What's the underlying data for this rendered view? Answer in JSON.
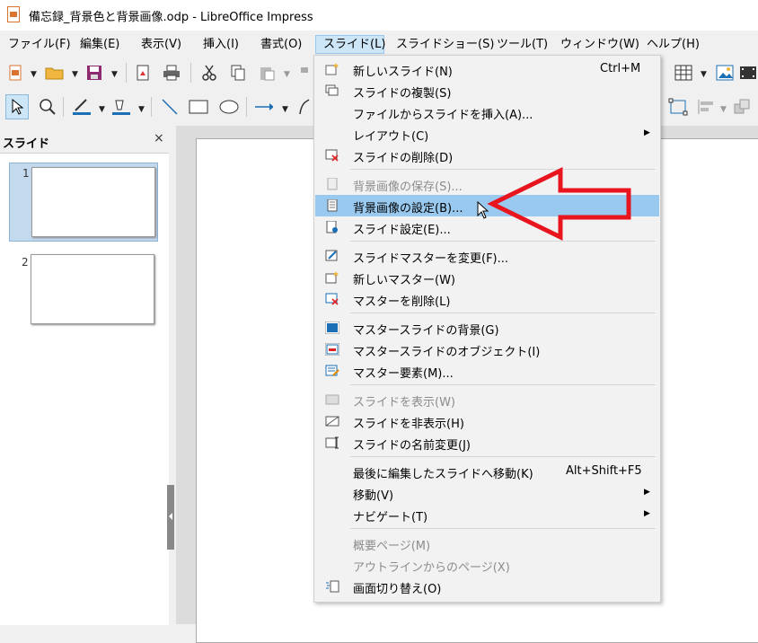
{
  "window": {
    "title": "備忘録_背景色と背景画像.odp - LibreOffice Impress"
  },
  "menubar": {
    "items": [
      "ファイル(F)",
      "編集(E)",
      "表示(V)",
      "挿入(I)",
      "書式(O)",
      "スライド(L)",
      "スライドショー(S)",
      "ツール(T)",
      "ウィンドウ(W)",
      "ヘルプ(H)"
    ],
    "active": "スライド(L)"
  },
  "slides_panel": {
    "title": "スライド",
    "close": "×",
    "slides": [
      {
        "number": "1",
        "selected": true
      },
      {
        "number": "2",
        "selected": false
      }
    ]
  },
  "slide_menu": {
    "highlighted": "背景画像の設定(B)...",
    "items": [
      {
        "label": "新しいスライド(N)",
        "shortcut": "Ctrl+M",
        "icon": "new-slide-icon",
        "enabled": true
      },
      {
        "label": "スライドの複製(S)",
        "icon": "duplicate-slide-icon",
        "enabled": true
      },
      {
        "label": "ファイルからスライドを挿入(A)...",
        "enabled": true
      },
      {
        "label": "レイアウト(C)",
        "submenu": true,
        "enabled": true
      },
      {
        "label": "スライドの削除(D)",
        "icon": "delete-slide-icon",
        "enabled": true
      },
      {
        "label": "背景画像の保存(S)...",
        "icon": "save-background-icon",
        "enabled": false
      },
      {
        "label": "背景画像の設定(B)...",
        "icon": "set-background-icon",
        "enabled": true
      },
      {
        "label": "スライド設定(E)...",
        "icon": "slide-properties-icon",
        "enabled": true
      },
      {
        "label": "スライドマスターを変更(F)...",
        "icon": "change-master-icon",
        "enabled": true
      },
      {
        "label": "新しいマスター(W)",
        "icon": "new-master-icon",
        "enabled": true
      },
      {
        "label": "マスターを削除(L)",
        "icon": "delete-master-icon",
        "enabled": true
      },
      {
        "label": "マスタースライドの背景(G)",
        "icon": "master-background-icon",
        "enabled": true
      },
      {
        "label": "マスタースライドのオブジェクト(I)",
        "icon": "master-objects-icon",
        "enabled": true
      },
      {
        "label": "マスター要素(M)...",
        "icon": "master-elements-icon",
        "enabled": true
      },
      {
        "label": "スライドを表示(W)",
        "icon": "show-slide-icon",
        "enabled": false
      },
      {
        "label": "スライドを非表示(H)",
        "icon": "hide-slide-icon",
        "enabled": true
      },
      {
        "label": "スライドの名前変更(J)",
        "icon": "rename-slide-icon",
        "enabled": true
      },
      {
        "label": "最後に編集したスライドへ移動(K)",
        "shortcut": "Alt+Shift+F5",
        "enabled": true
      },
      {
        "label": "移動(V)",
        "submenu": true,
        "enabled": true
      },
      {
        "label": "ナビゲート(T)",
        "submenu": true,
        "enabled": true
      },
      {
        "label": "概要ページ(M)",
        "enabled": false
      },
      {
        "label": "アウトラインからのページ(X)",
        "enabled": false
      },
      {
        "label": "画面切り替え(O)",
        "icon": "transition-icon",
        "enabled": true
      }
    ]
  },
  "colors": {
    "highlight": "#99c9ef",
    "active_menu": "#cde6f7",
    "annotation_arrow": "#e8141e"
  }
}
